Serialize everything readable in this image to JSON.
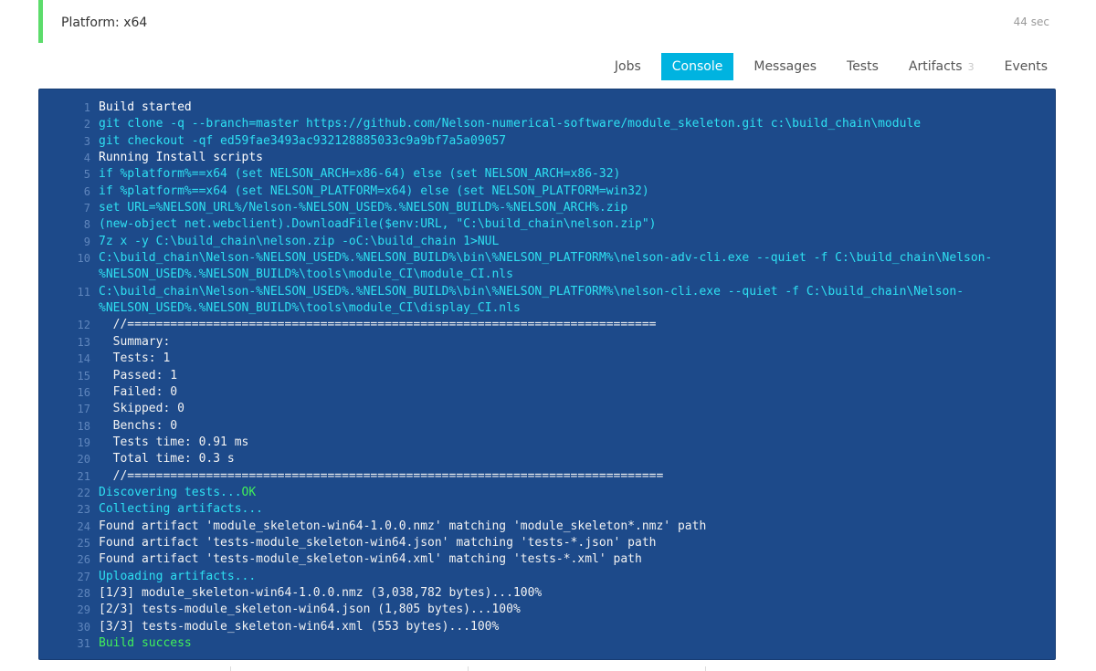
{
  "job": {
    "title": "Platform: x64",
    "duration": "44 sec"
  },
  "tabs": [
    {
      "label": "Jobs"
    },
    {
      "label": "Console"
    },
    {
      "label": "Messages"
    },
    {
      "label": "Tests"
    },
    {
      "label": "Artifacts",
      "badge": "3"
    },
    {
      "label": "Events"
    }
  ],
  "console": {
    "lines": [
      {
        "n": "1",
        "text": "Build started"
      },
      {
        "n": "2",
        "text": "git clone -q --branch=master https://github.com/Nelson-numerical-software/module_skeleton.git c:\\build_chain\\module"
      },
      {
        "n": "3",
        "text": "git checkout -qf ed59fae3493ac932128885033c9a9bf7a5a09057"
      },
      {
        "n": "4",
        "text": "Running Install scripts"
      },
      {
        "n": "5",
        "text": "if %platform%==x64 (set NELSON_ARCH=x86-64) else (set NELSON_ARCH=x86-32)"
      },
      {
        "n": "6",
        "text": "if %platform%==x64 (set NELSON_PLATFORM=x64) else (set NELSON_PLATFORM=win32)"
      },
      {
        "n": "7",
        "text": "set URL=%NELSON_URL%/Nelson-%NELSON_USED%.%NELSON_BUILD%-%NELSON_ARCH%.zip"
      },
      {
        "n": "8",
        "text": "(new-object net.webclient).DownloadFile($env:URL, \"C:\\build_chain\\nelson.zip\")"
      },
      {
        "n": "9",
        "text": "7z x -y C:\\build_chain\\nelson.zip -oC:\\build_chain 1>NUL"
      },
      {
        "n": "10",
        "text": "C:\\build_chain\\Nelson-%NELSON_USED%.%NELSON_BUILD%\\bin\\%NELSON_PLATFORM%\\nelson-adv-cli.exe --quiet -f C:\\build_chain\\Nelson-",
        "text2": "%NELSON_USED%.%NELSON_BUILD%\\tools\\module_CI\\module_CI.nls"
      },
      {
        "n": "11",
        "text": "C:\\build_chain\\Nelson-%NELSON_USED%.%NELSON_BUILD%\\bin\\%NELSON_PLATFORM%\\nelson-cli.exe --quiet -f C:\\build_chain\\Nelson-",
        "text2": "%NELSON_USED%.%NELSON_BUILD%\\tools\\module_CI\\display_CI.nls"
      },
      {
        "n": "12",
        "text": "  //=========================================================================="
      },
      {
        "n": "13",
        "text": "  Summary:"
      },
      {
        "n": "14",
        "text": "  Tests: 1"
      },
      {
        "n": "15",
        "text": "  Passed: 1"
      },
      {
        "n": "16",
        "text": "  Failed: 0"
      },
      {
        "n": "17",
        "text": "  Skipped: 0"
      },
      {
        "n": "18",
        "text": "  Benchs: 0"
      },
      {
        "n": "19",
        "text": "  Tests time: 0.91 ms"
      },
      {
        "n": "20",
        "text": "  Total time: 0.3 s"
      },
      {
        "n": "21",
        "text": "  //==========================================================================="
      },
      {
        "n": "22",
        "text": "Discovering tests...",
        "suffix": "OK"
      },
      {
        "n": "23",
        "text": "Collecting artifacts..."
      },
      {
        "n": "24",
        "text": "Found artifact 'module_skeleton-win64-1.0.0.nmz' matching 'module_skeleton*.nmz' path"
      },
      {
        "n": "25",
        "text": "Found artifact 'tests-module_skeleton-win64.json' matching 'tests-*.json' path"
      },
      {
        "n": "26",
        "text": "Found artifact 'tests-module_skeleton-win64.xml' matching 'tests-*.xml' path"
      },
      {
        "n": "27",
        "text": "Uploading artifacts..."
      },
      {
        "n": "28",
        "text": "[1/3] module_skeleton-win64-1.0.0.nmz (3,038,782 bytes)...100%"
      },
      {
        "n": "29",
        "text": "[2/3] tests-module_skeleton-win64.json (1,805 bytes)...100%"
      },
      {
        "n": "30",
        "text": "[3/3] tests-module_skeleton-win64.xml (553 bytes)...100%"
      },
      {
        "n": "31",
        "text": "Build success"
      }
    ]
  },
  "colors": {
    "console_bg": "#1d4a8a",
    "cyan": "#2ee0f2",
    "green": "#41f05a",
    "tab_active": "#00b3e0",
    "status_bar": "#5cdc6b"
  }
}
